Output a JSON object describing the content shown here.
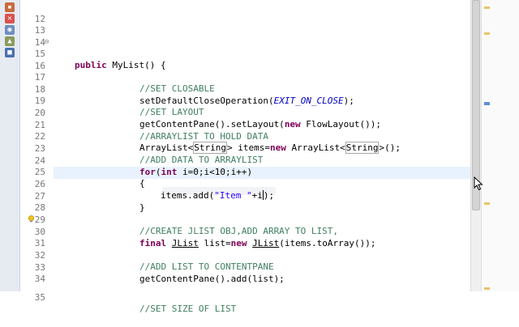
{
  "editor": {
    "lines": [
      {
        "num": "12",
        "code": ""
      },
      {
        "num": "13",
        "code": ""
      },
      {
        "num": "14",
        "code": ""
      },
      {
        "num": "15",
        "code": "public MyList() {"
      },
      {
        "num": "16",
        "code": ""
      },
      {
        "num": "17",
        "code": "//SET CLOSABLE"
      },
      {
        "num": "18",
        "code": "setDefaultCloseOperation(EXIT_ON_CLOSE);"
      },
      {
        "num": "19",
        "code": "//SET LAYOUT"
      },
      {
        "num": "20",
        "code": "getContentPane().setLayout(new FlowLayout());"
      },
      {
        "num": "21",
        "code": "//ARRAYLIST TO HOLD DATA"
      },
      {
        "num": "22",
        "code": "ArrayList<String> items=new ArrayList<String>();"
      },
      {
        "num": "23",
        "code": "//ADD DATA TO ARRAYLIST"
      },
      {
        "num": "24",
        "code": "for(int i=0;i<10;i++)"
      },
      {
        "num": "25",
        "code": "{"
      },
      {
        "num": "26",
        "code": "items.add(\"Item \"+i);"
      },
      {
        "num": "27",
        "code": "}"
      },
      {
        "num": "28",
        "code": ""
      },
      {
        "num": "29",
        "code": "//CREATE JLIST OBJ,ADD ARRAY TO LIST,"
      },
      {
        "num": "30",
        "code": "final JList list=new JList(items.toArray());"
      },
      {
        "num": "31",
        "code": ""
      },
      {
        "num": "32",
        "code": "//ADD LIST TO CONTENTPANE"
      },
      {
        "num": "33",
        "code": "getContentPane().add(list);"
      },
      {
        "num": "34",
        "code": ""
      },
      {
        "num": "35",
        "code": "//SET SIZE OF LIST"
      }
    ]
  },
  "colors": {
    "keyword": "#7f0055",
    "comment": "#3f7f5f",
    "string": "#2a00ff",
    "constant": "#0000c0",
    "line_number": "#787878"
  },
  "icons": [
    "bookmark-icon",
    "error-icon",
    "warning-icon",
    "task-icon",
    "info-icon"
  ]
}
